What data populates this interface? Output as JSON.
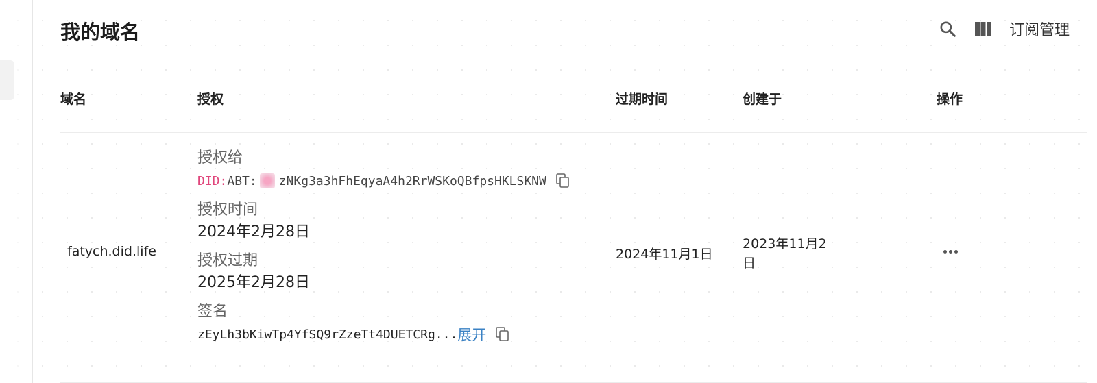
{
  "page": {
    "title": "我的域名"
  },
  "toolbar": {
    "search_icon": "search-icon",
    "columns_icon": "columns-icon",
    "subscription_label": "订阅管理"
  },
  "table": {
    "headers": {
      "domain": "域名",
      "authorization": "授权",
      "expiry": "过期时间",
      "created": "创建于",
      "actions": "操作"
    },
    "rows": [
      {
        "domain": "fatych.did.life",
        "auth_to_label": "授权给",
        "did_prefix": "DID:",
        "did_type": "ABT:",
        "did_value": "zNKg3a3hFhEqyaA4h2RrWSKoQBfpsHKLSKNW",
        "auth_time_label": "授权时间",
        "auth_time": "2024年2月28日",
        "auth_expire_label": "授权过期",
        "auth_expire": "2025年2月28日",
        "signature_label": "签名",
        "signature": "zEyLh3bKiwTp4YfSQ9rZzeTt4DUETCRg...",
        "expand_label": "展开",
        "expiry": "2024年11月1日",
        "created_line1": "2023年11月2",
        "created_line2": "日"
      }
    ]
  },
  "colors": {
    "did_prefix": "#e0457b",
    "link": "#3b82c4"
  }
}
